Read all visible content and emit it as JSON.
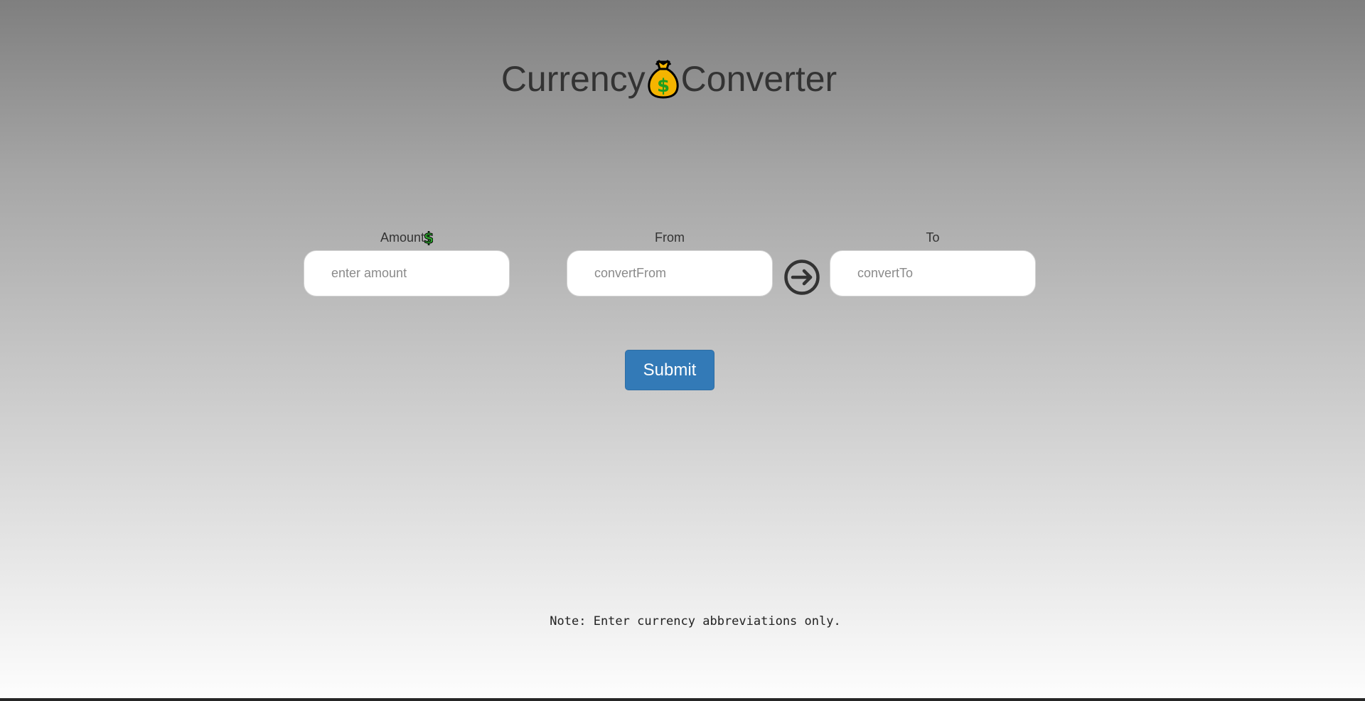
{
  "header": {
    "title_part1": "Currency",
    "title_icon": "money-bag-icon",
    "title_part2": "Converter"
  },
  "form": {
    "amount": {
      "label": "Amount",
      "label_icon": "dollar-sign-icon",
      "placeholder": "enter amount",
      "value": ""
    },
    "from": {
      "label": "From",
      "placeholder": "convertFrom",
      "value": ""
    },
    "swap_icon": "circled-arrow-right-icon",
    "to": {
      "label": "To",
      "placeholder": "convertTo",
      "value": ""
    },
    "submit_label": "Submit"
  },
  "footer": {
    "note": "Note: Enter currency abbreviations only."
  },
  "colors": {
    "accent": "#337ab7",
    "text": "#333333",
    "money_bag": "#f4b400",
    "dollar": "#2ea82e"
  }
}
